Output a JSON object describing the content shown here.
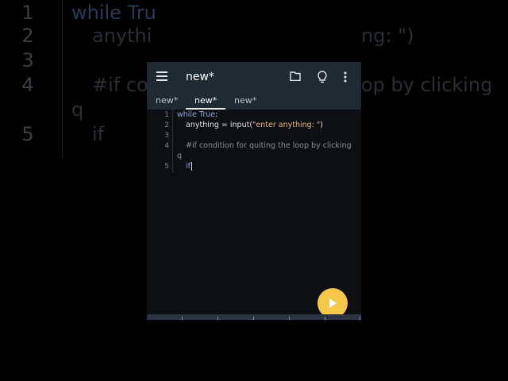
{
  "background": {
    "lines": [
      {
        "num": "1",
        "code": "while Tru"
      },
      {
        "num": "2",
        "code": "anythi"
      },
      {
        "num": "3",
        "code": ""
      },
      {
        "num": "4",
        "code": "#if co"
      },
      {
        "num": "5",
        "code": "if"
      }
    ],
    "right_fragment_1": "ng: \")",
    "right_fragment_2": "op by clicking",
    "wrap_q": "q"
  },
  "toolbar": {
    "title": "new*"
  },
  "tabs": [
    {
      "label": "new*"
    },
    {
      "label": "new*"
    },
    {
      "label": "new*"
    }
  ],
  "editor": {
    "line_numbers": [
      "1",
      "2",
      "3",
      "4",
      "5"
    ],
    "line1_kw": "while True",
    "line1_rest": ":",
    "line2_prefix": "anything = input(",
    "line2_str": "\"enter anything: \"",
    "line2_suffix": ")",
    "line4_comment": "#if condition for quiting the loop by clicking",
    "line4_wrap": "q",
    "line5_kw": "if"
  },
  "colors": {
    "toolbar": "#1f2a33",
    "editor_bg": "#0d0f12",
    "fab": "#f6c84a",
    "keyword": "#8fa6d9",
    "string": "#e6b98a"
  }
}
